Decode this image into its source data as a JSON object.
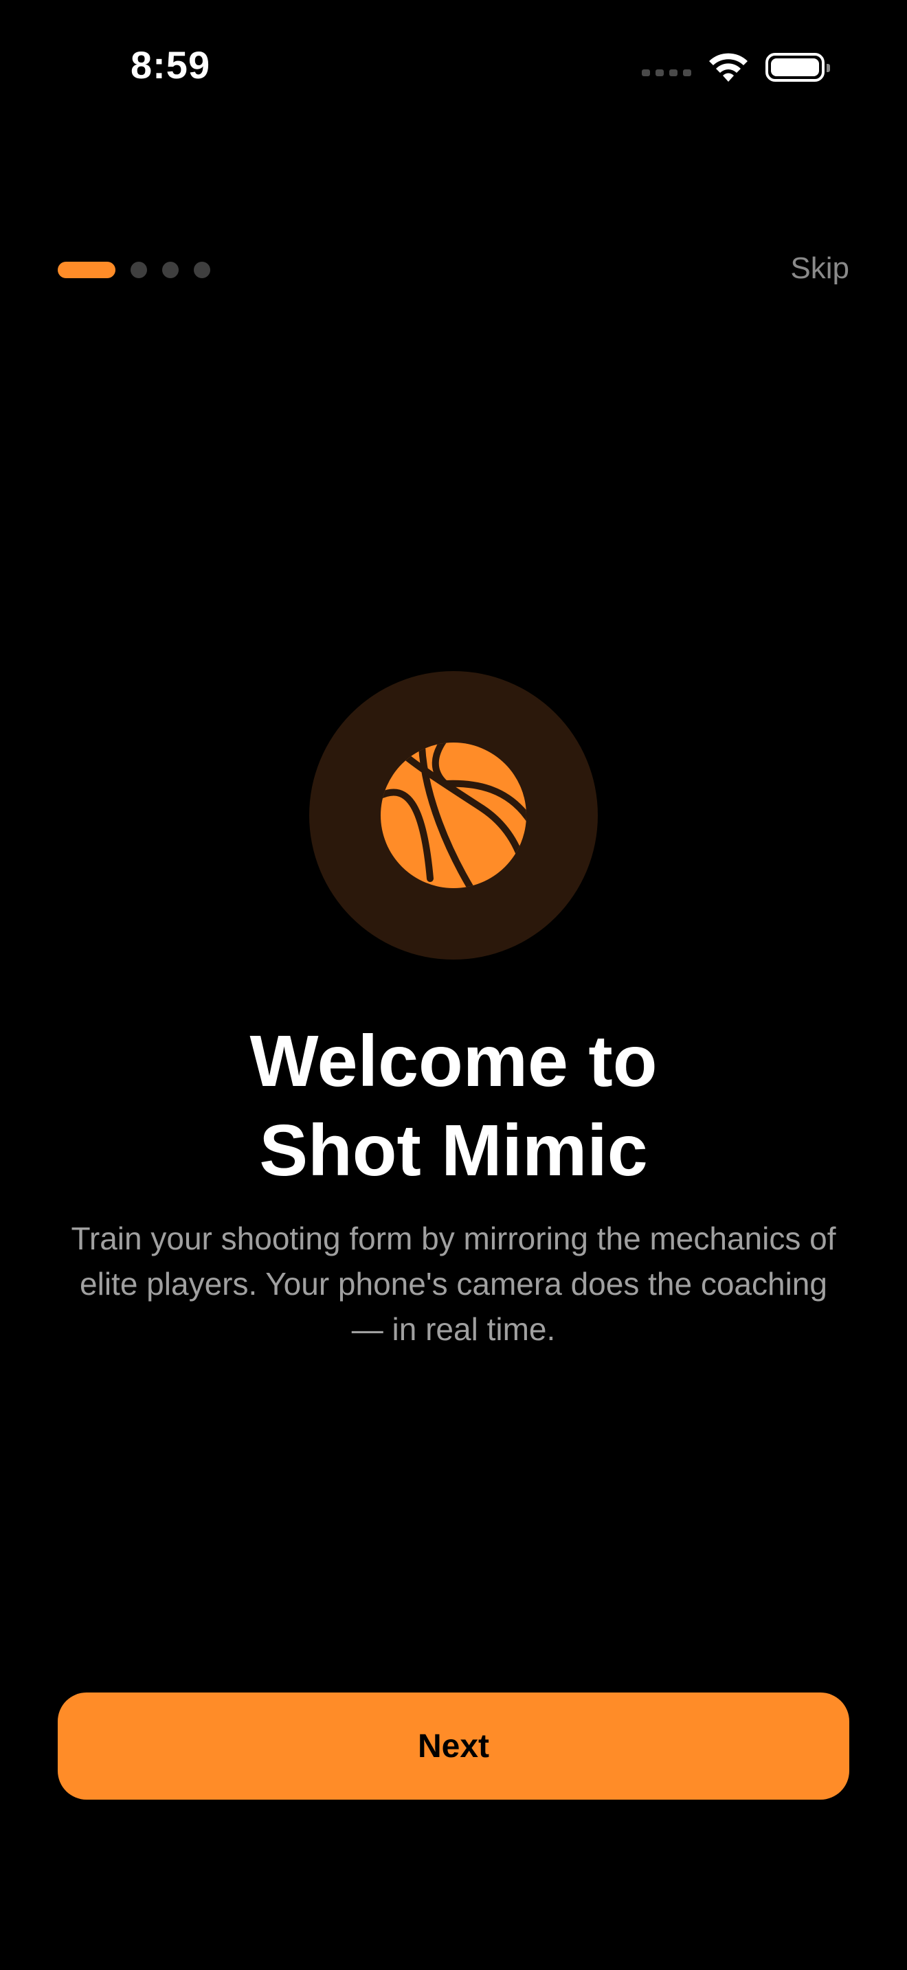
{
  "status_bar": {
    "time": "8:59"
  },
  "onboarding": {
    "skip_label": "Skip",
    "pages_total": 4,
    "current_page": 1,
    "hero_icon": "basketball-icon",
    "title_line1": "Welcome to",
    "title_line2": "Shot Mimic",
    "description": "Train your shooting form by mirroring the mechanics of elite players. Your phone's camera does the coaching — in real time.",
    "next_label": "Next"
  },
  "colors": {
    "accent": "#ff8c28",
    "background": "#000000",
    "hero_circle": "#2b180b",
    "muted_text": "#a0a0a0"
  }
}
